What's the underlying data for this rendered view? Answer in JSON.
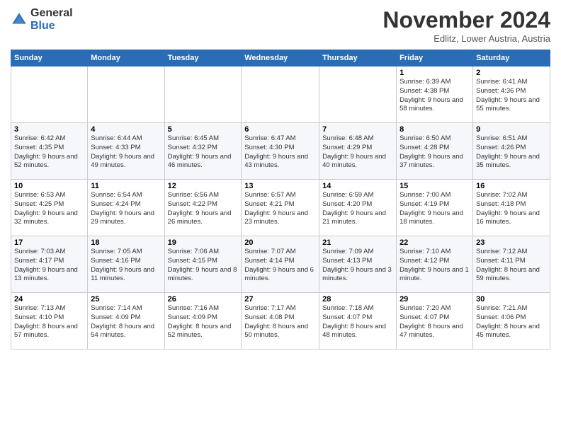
{
  "header": {
    "logo_line1": "General",
    "logo_line2": "Blue",
    "month": "November 2024",
    "location": "Edlitz, Lower Austria, Austria"
  },
  "weekdays": [
    "Sunday",
    "Monday",
    "Tuesday",
    "Wednesday",
    "Thursday",
    "Friday",
    "Saturday"
  ],
  "weeks": [
    [
      {
        "day": "",
        "info": ""
      },
      {
        "day": "",
        "info": ""
      },
      {
        "day": "",
        "info": ""
      },
      {
        "day": "",
        "info": ""
      },
      {
        "day": "",
        "info": ""
      },
      {
        "day": "1",
        "info": "Sunrise: 6:39 AM\nSunset: 4:38 PM\nDaylight: 9 hours and 58 minutes."
      },
      {
        "day": "2",
        "info": "Sunrise: 6:41 AM\nSunset: 4:36 PM\nDaylight: 9 hours and 55 minutes."
      }
    ],
    [
      {
        "day": "3",
        "info": "Sunrise: 6:42 AM\nSunset: 4:35 PM\nDaylight: 9 hours and 52 minutes."
      },
      {
        "day": "4",
        "info": "Sunrise: 6:44 AM\nSunset: 4:33 PM\nDaylight: 9 hours and 49 minutes."
      },
      {
        "day": "5",
        "info": "Sunrise: 6:45 AM\nSunset: 4:32 PM\nDaylight: 9 hours and 46 minutes."
      },
      {
        "day": "6",
        "info": "Sunrise: 6:47 AM\nSunset: 4:30 PM\nDaylight: 9 hours and 43 minutes."
      },
      {
        "day": "7",
        "info": "Sunrise: 6:48 AM\nSunset: 4:29 PM\nDaylight: 9 hours and 40 minutes."
      },
      {
        "day": "8",
        "info": "Sunrise: 6:50 AM\nSunset: 4:28 PM\nDaylight: 9 hours and 37 minutes."
      },
      {
        "day": "9",
        "info": "Sunrise: 6:51 AM\nSunset: 4:26 PM\nDaylight: 9 hours and 35 minutes."
      }
    ],
    [
      {
        "day": "10",
        "info": "Sunrise: 6:53 AM\nSunset: 4:25 PM\nDaylight: 9 hours and 32 minutes."
      },
      {
        "day": "11",
        "info": "Sunrise: 6:54 AM\nSunset: 4:24 PM\nDaylight: 9 hours and 29 minutes."
      },
      {
        "day": "12",
        "info": "Sunrise: 6:56 AM\nSunset: 4:22 PM\nDaylight: 9 hours and 26 minutes."
      },
      {
        "day": "13",
        "info": "Sunrise: 6:57 AM\nSunset: 4:21 PM\nDaylight: 9 hours and 23 minutes."
      },
      {
        "day": "14",
        "info": "Sunrise: 6:59 AM\nSunset: 4:20 PM\nDaylight: 9 hours and 21 minutes."
      },
      {
        "day": "15",
        "info": "Sunrise: 7:00 AM\nSunset: 4:19 PM\nDaylight: 9 hours and 18 minutes."
      },
      {
        "day": "16",
        "info": "Sunrise: 7:02 AM\nSunset: 4:18 PM\nDaylight: 9 hours and 16 minutes."
      }
    ],
    [
      {
        "day": "17",
        "info": "Sunrise: 7:03 AM\nSunset: 4:17 PM\nDaylight: 9 hours and 13 minutes."
      },
      {
        "day": "18",
        "info": "Sunrise: 7:05 AM\nSunset: 4:16 PM\nDaylight: 9 hours and 11 minutes."
      },
      {
        "day": "19",
        "info": "Sunrise: 7:06 AM\nSunset: 4:15 PM\nDaylight: 9 hours and 8 minutes."
      },
      {
        "day": "20",
        "info": "Sunrise: 7:07 AM\nSunset: 4:14 PM\nDaylight: 9 hours and 6 minutes."
      },
      {
        "day": "21",
        "info": "Sunrise: 7:09 AM\nSunset: 4:13 PM\nDaylight: 9 hours and 3 minutes."
      },
      {
        "day": "22",
        "info": "Sunrise: 7:10 AM\nSunset: 4:12 PM\nDaylight: 9 hours and 1 minute."
      },
      {
        "day": "23",
        "info": "Sunrise: 7:12 AM\nSunset: 4:11 PM\nDaylight: 8 hours and 59 minutes."
      }
    ],
    [
      {
        "day": "24",
        "info": "Sunrise: 7:13 AM\nSunset: 4:10 PM\nDaylight: 8 hours and 57 minutes."
      },
      {
        "day": "25",
        "info": "Sunrise: 7:14 AM\nSunset: 4:09 PM\nDaylight: 8 hours and 54 minutes."
      },
      {
        "day": "26",
        "info": "Sunrise: 7:16 AM\nSunset: 4:09 PM\nDaylight: 8 hours and 52 minutes."
      },
      {
        "day": "27",
        "info": "Sunrise: 7:17 AM\nSunset: 4:08 PM\nDaylight: 8 hours and 50 minutes."
      },
      {
        "day": "28",
        "info": "Sunrise: 7:18 AM\nSunset: 4:07 PM\nDaylight: 8 hours and 48 minutes."
      },
      {
        "day": "29",
        "info": "Sunrise: 7:20 AM\nSunset: 4:07 PM\nDaylight: 8 hours and 47 minutes."
      },
      {
        "day": "30",
        "info": "Sunrise: 7:21 AM\nSunset: 4:06 PM\nDaylight: 8 hours and 45 minutes."
      }
    ]
  ]
}
